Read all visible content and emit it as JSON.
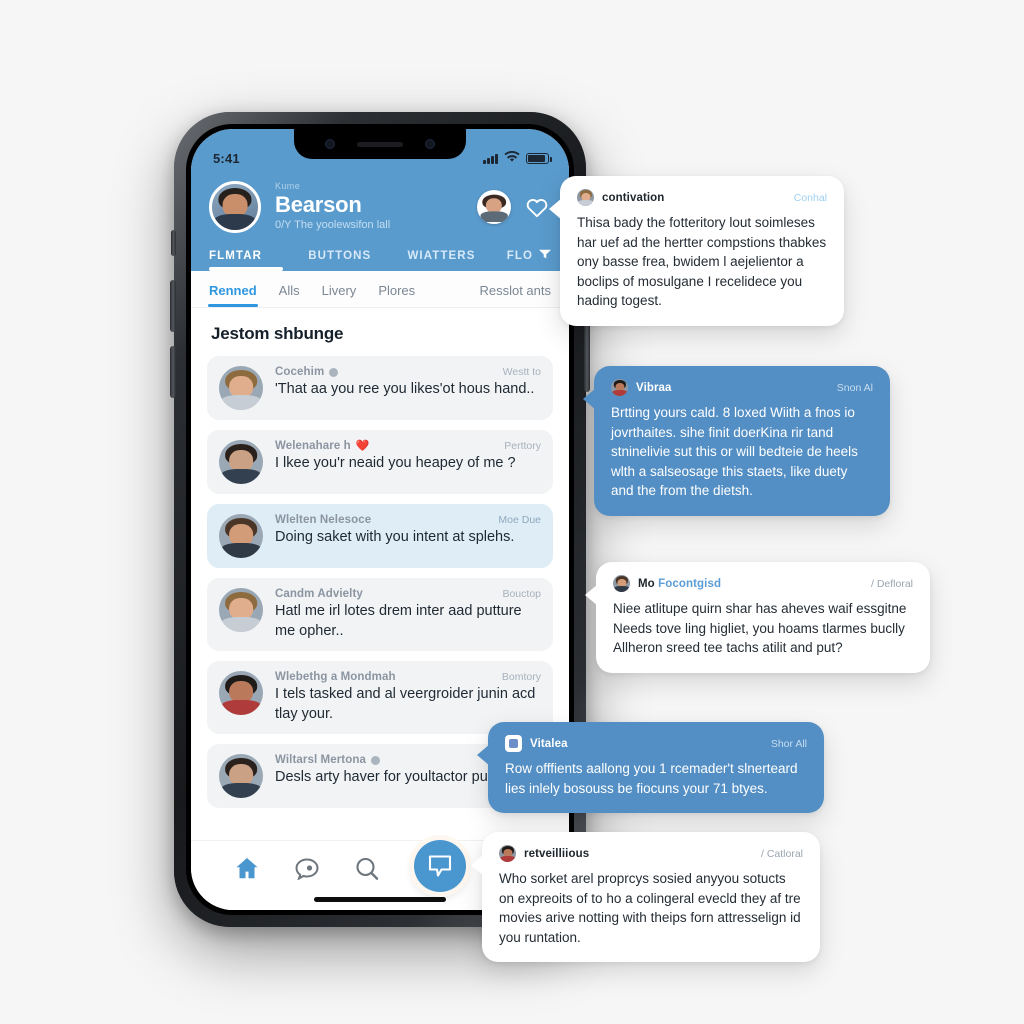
{
  "status_bar": {
    "time": "5:41",
    "signal_icon": "cellular-bars-icon",
    "wifi_icon": "wifi-icon",
    "battery_icon": "battery-icon"
  },
  "header": {
    "kicker": "Kume",
    "name": "Bearson",
    "subtitle": "0/Y The yoolewsifon lall",
    "avatar_icon": "profile-avatar",
    "secondary_avatar_icon": "secondary-avatar",
    "heart_icon": "heart-outline-icon",
    "accent_color": "#5a9bcd",
    "tabs": [
      {
        "label": "FLMTAR",
        "active": true
      },
      {
        "label": "BUTTONS",
        "active": false
      },
      {
        "label": "WIATTERS",
        "active": false
      },
      {
        "label": "FLO",
        "active": false,
        "icon": "filter-icon"
      }
    ]
  },
  "subtabs": [
    {
      "label": "Renned",
      "active": true
    },
    {
      "label": "Alls",
      "active": false
    },
    {
      "label": "Livery",
      "active": false
    },
    {
      "label": "Plores",
      "active": false
    },
    {
      "label": "Resslot ants",
      "active": false,
      "end": true
    }
  ],
  "list": {
    "title": "Jestom shbunge",
    "rows": [
      {
        "name": "Cocehim",
        "badge": true,
        "heart": false,
        "meta": "Westt to",
        "message": "'That aa you ree you likes'ot hous hand..",
        "selected": false
      },
      {
        "name": "Welenahare h",
        "badge": false,
        "heart": true,
        "meta": "Perttory",
        "message": "I lkee you'r neaid you heapey of me ?",
        "selected": false
      },
      {
        "name": "Wlelten Nelesoce",
        "badge": false,
        "heart": false,
        "meta": "Moe Due",
        "message": "Doing saket with you intent at splehs.",
        "selected": true
      },
      {
        "name": "Candm Advielty",
        "badge": false,
        "heart": false,
        "meta": "Bouctop",
        "message": "Hatl me irl lotes drem inter aad putture me opher..",
        "selected": false
      },
      {
        "name": "Wlebethg a Mondmah",
        "badge": false,
        "heart": false,
        "meta": "Bomtory",
        "message": "I tels tasked and al veergroider junin acd tlay your.",
        "selected": false
      },
      {
        "name": "Wiltarsl Mertona",
        "badge": true,
        "heart": false,
        "meta": "",
        "message": "Desls arty haver for youltactor pusilte",
        "selected": false
      }
    ]
  },
  "bottom_nav": [
    {
      "icon": "home-icon",
      "active": true
    },
    {
      "icon": "chat-bubble-icon",
      "active": false
    },
    {
      "icon": "search-icon",
      "active": false
    },
    {
      "icon": "message-fab-icon",
      "fab": true
    },
    {
      "icon": "envelope-icon",
      "active": false
    }
  ],
  "bubbles": [
    {
      "id": "b1",
      "style": "white",
      "tail": "left-w",
      "name": "contivation",
      "name_accent": "",
      "meta": "Conhal",
      "meta_link": true,
      "avatar_icon": "bubble-avatar-1",
      "text": "Thisa bady the fotteritory lout soimleses har uef ad the hertter compstions thabkes ony basse frea, bwidem l aejelientor a boclips of mosulgane I recelidece you hading togest."
    },
    {
      "id": "b2",
      "style": "blue",
      "tail": "left-b",
      "name": "Vibraa",
      "name_accent": "",
      "meta": "Snon Al",
      "meta_link": false,
      "avatar_icon": "bubble-avatar-2",
      "text": "Brtting yours cald. 8 loxed Wiith a fnos io jovrthaites. sihe finit doerKina rir tand stninelivie sut this or will bedteie de heels wlth a salseosage this staets, like duety and the from the dietsh."
    },
    {
      "id": "b3",
      "style": "white",
      "tail": "left-w",
      "name": "Mo ",
      "name_accent": "Focontgisd",
      "meta": "/ Defloral",
      "meta_link": false,
      "avatar_icon": "bubble-avatar-3",
      "text": "Niee atlitupe quirn shar has aheves waif essgitne Needs tove ling higliet, you hoams tlarmes buclly Allheron sreed tee tachs atilit and put?"
    },
    {
      "id": "b4",
      "style": "blue",
      "tail": "left-b",
      "name": "Vitalea",
      "name_accent": "",
      "meta": "Shor All",
      "meta_link": false,
      "avatar_icon": "bubble-avatar-4",
      "text": "Row offfients aallong you 1 rcemader't slnerteard lies inlely bosouss be fiocuns your 71 btyes."
    },
    {
      "id": "b5",
      "style": "white",
      "tail": "left-w",
      "name": "retveilliious",
      "name_accent": "",
      "meta": "/ Catloral",
      "meta_link": false,
      "avatar_icon": "bubble-avatar-5",
      "text": "Who sorket arel proprcys sosied anyyou sotucts on expreoits of to ho a colingeral evecld they af tre movies arive notting with theips forn attresselign id you runtation."
    }
  ]
}
